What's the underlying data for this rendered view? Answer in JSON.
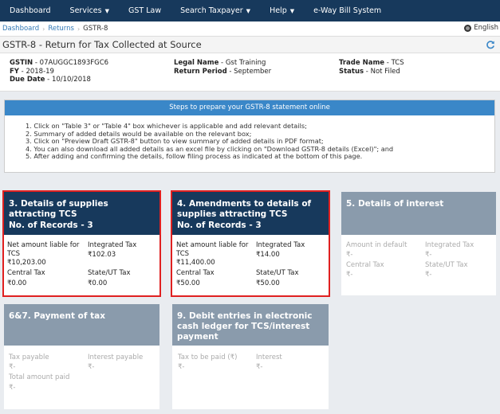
{
  "nav": {
    "items": [
      {
        "label": "Dashboard",
        "caret": false
      },
      {
        "label": "Services",
        "caret": true
      },
      {
        "label": "GST Law",
        "caret": false
      },
      {
        "label": "Search Taxpayer",
        "caret": true
      },
      {
        "label": "Help",
        "caret": true
      },
      {
        "label": "e-Way Bill System",
        "caret": false
      }
    ]
  },
  "breadcrumb": {
    "items": [
      "Dashboard",
      "Returns",
      "GSTR-8"
    ],
    "language": "English"
  },
  "page": {
    "title": "GSTR-8 - Return for Tax Collected at Source"
  },
  "info": {
    "gstin_label": "GSTIN",
    "gstin": "07AUGGC1893FGC6",
    "fy_label": "FY",
    "fy": "2018-19",
    "due_label": "Due Date",
    "due": "10/10/2018",
    "legal_label": "Legal Name",
    "legal": "Gst Training",
    "period_label": "Return Period",
    "period": "September",
    "trade_label": "Trade Name",
    "trade": "TCS",
    "status_label": "Status",
    "status": "Not Filed"
  },
  "steps": {
    "heading": "Steps to prepare your GSTR-8 statement online",
    "items": [
      "1. Click on \"Table 3\" or \"Table 4\" box whichever is applicable and add relevant details;",
      "2. Summary of added details would be available on the relevant box;",
      "3. Click on \"Preview Draft GSTR-8\" button to view summary of added details in PDF format;",
      "4. You can also download all added details as an excel file by clicking on \"Download GSTR-8 details (Excel)\"; and",
      "5. After adding and confirming the details, follow filing process as indicated at the bottom of this page."
    ]
  },
  "tiles": {
    "t3": {
      "title": "3. Details of supplies attracting TCS",
      "records": "No. of Records - 3",
      "net_label": "Net amount liable for TCS",
      "net_value": "₹10,203.00",
      "igst_label": "Integrated Tax",
      "igst_value": "₹102.03",
      "cgst_label": "Central Tax",
      "cgst_value": "₹0.00",
      "sgst_label": "State/UT Tax",
      "sgst_value": "₹0.00"
    },
    "t4": {
      "title": "4. Amendments to details of supplies attracting TCS",
      "records": "No. of Records - 3",
      "net_label": "Net amount liable for TCS",
      "net_value": "₹11,400.00",
      "igst_label": "Integrated Tax",
      "igst_value": "₹14.00",
      "cgst_label": "Central Tax",
      "cgst_value": "₹50.00",
      "sgst_label": "State/UT Tax",
      "sgst_value": "₹50.00"
    },
    "t5": {
      "title": "5. Details of interest",
      "default_label": "Amount in default",
      "default_value": "₹-",
      "igst_label": "Integrated Tax",
      "igst_value": "₹-",
      "cgst_label": "Central Tax",
      "cgst_value": "₹-",
      "sgst_label": "State/UT Tax",
      "sgst_value": "₹-"
    },
    "t67": {
      "title": "6&7. Payment of tax",
      "tax_label": "Tax payable",
      "tax_value": "₹-",
      "int_label": "Interest payable",
      "int_value": "₹-",
      "total_label": "Total amount paid",
      "total_value": "₹-"
    },
    "t9": {
      "title": "9. Debit entries in electronic cash ledger for TCS/interest payment",
      "tax_label": "Tax to be paid (₹)",
      "tax_value": "₹-",
      "int_label": "Interest",
      "int_value": "₹-"
    }
  },
  "colors": {
    "nav_bg": "#17395c",
    "tile_active": "#17395c",
    "tile_disabled": "#8a9bac",
    "steps_head": "#3a87c8",
    "highlight": "#e02020",
    "link": "#337ab7"
  }
}
